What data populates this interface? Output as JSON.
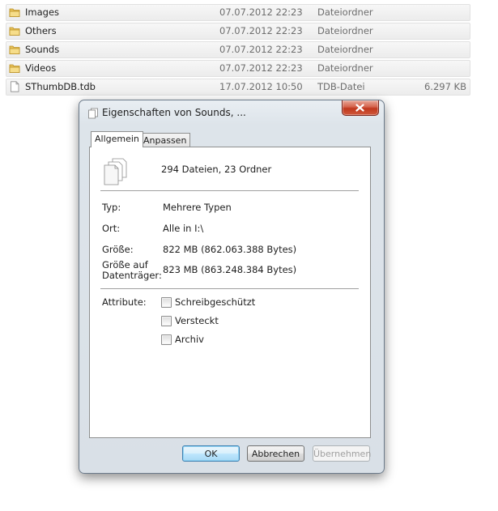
{
  "file_list": [
    {
      "name": "Images",
      "date": "07.07.2012 22:23",
      "type": "Dateiordner",
      "size": "",
      "icon": "folder-icon"
    },
    {
      "name": "Others",
      "date": "07.07.2012 22:23",
      "type": "Dateiordner",
      "size": "",
      "icon": "folder-icon"
    },
    {
      "name": "Sounds",
      "date": "07.07.2012 22:23",
      "type": "Dateiordner",
      "size": "",
      "icon": "folder-icon"
    },
    {
      "name": "Videos",
      "date": "07.07.2012 22:23",
      "type": "Dateiordner",
      "size": "",
      "icon": "folder-icon"
    },
    {
      "name": "SThumbDB.tdb",
      "date": "17.07.2012 10:50",
      "type": "TDB-Datei",
      "size": "6.297 KB",
      "icon": "file-icon"
    }
  ],
  "dialog": {
    "title": "Eigenschaften von Sounds, ...",
    "tabs": [
      "Allgemein",
      "Anpassen"
    ],
    "active_tab": "Allgemein",
    "summary": "294 Dateien, 23 Ordner",
    "props": {
      "type_label": "Typ:",
      "type_value": "Mehrere Typen",
      "location_label": "Ort:",
      "location_value": "Alle in I:\\",
      "size_label": "Größe:",
      "size_value": "822 MB (862.063.388 Bytes)",
      "disk_size_label_1": "Größe auf",
      "disk_size_label_2": "Datenträger:",
      "disk_size_value": "823 MB (863.248.384 Bytes)"
    },
    "attributes_label": "Attribute:",
    "attributes": [
      {
        "label": "Schreibgeschützt",
        "checked": false
      },
      {
        "label": "Versteckt",
        "checked": false
      },
      {
        "label": "Archiv",
        "checked": false
      }
    ],
    "buttons": {
      "ok": "OK",
      "cancel": "Abbrechen",
      "apply": "Übernehmen"
    },
    "colors": {
      "close_button": "#c8452a",
      "default_button_border": "#3c7fb1",
      "folder": "#e8c25a"
    }
  }
}
